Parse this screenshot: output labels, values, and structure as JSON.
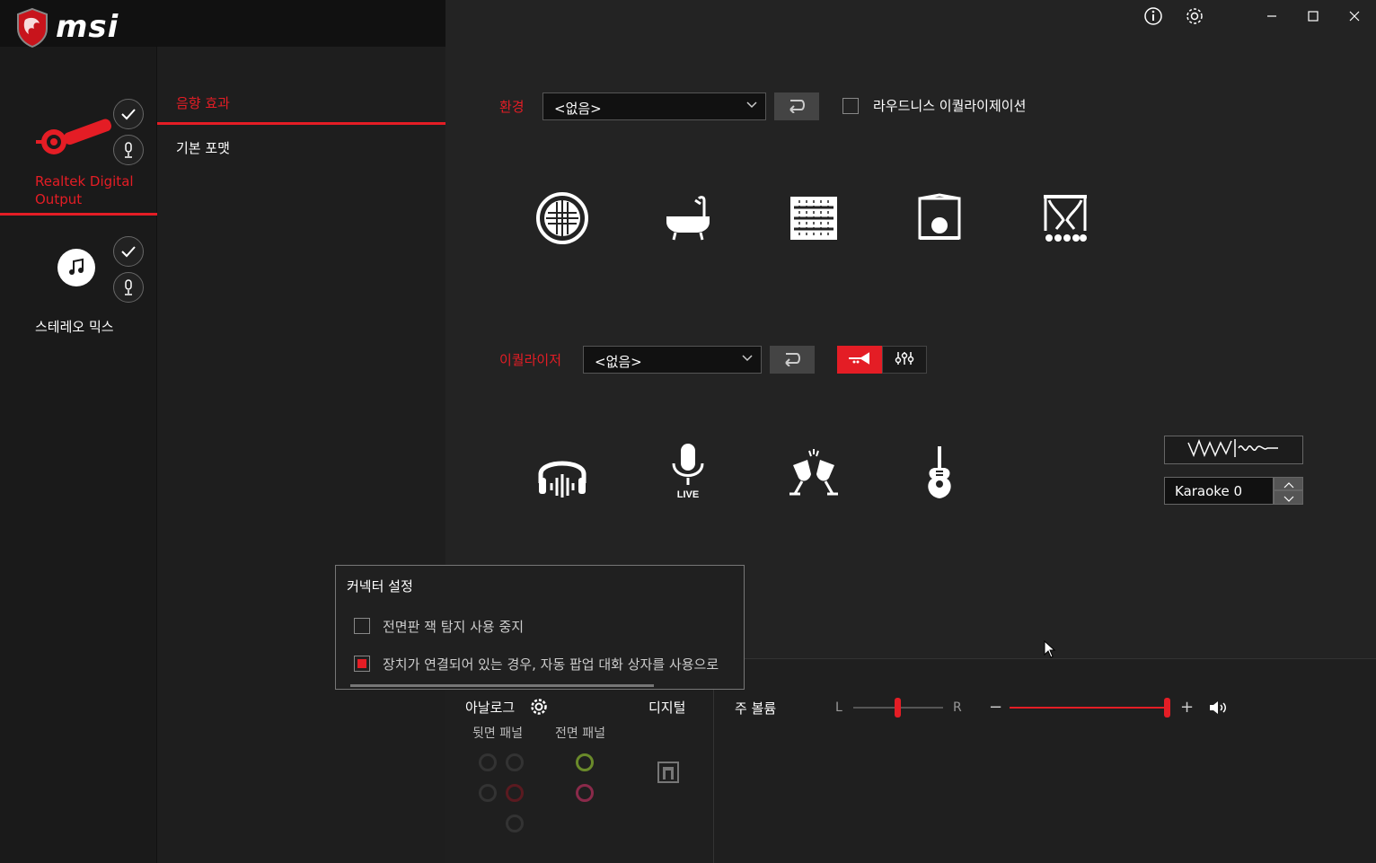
{
  "brand": {
    "logo_text": "msi"
  },
  "window_controls": {
    "info": "info",
    "settings": "settings",
    "minimize": "minimize",
    "maximize": "maximize",
    "close": "close"
  },
  "devices": [
    {
      "label": "Realtek Digital Output",
      "active": true
    },
    {
      "label": "스테레오 믹스",
      "active": false
    }
  ],
  "tabs": [
    {
      "label": "음향 효과",
      "active": true
    },
    {
      "label": "기본 포맷",
      "active": false
    }
  ],
  "environment": {
    "label": "환경",
    "value": "<없음>",
    "loudness_label": "라우드니스 이퀄라이제이션"
  },
  "env_icons": [
    "hall-icon",
    "bathroom-icon",
    "arena-icon",
    "stage-icon",
    "theater-icon"
  ],
  "equalizer": {
    "label": "이퀄라이저",
    "value": "<없음>"
  },
  "eq_icons": [
    "headphones-icon",
    "live-mic-icon",
    "party-icon",
    "guitar-icon"
  ],
  "karaoke": {
    "value": "Karaoke 0"
  },
  "connector_popup": {
    "title": "커넥터 설정",
    "option1": "전면판 잭 탐지 사용 중지",
    "option2": "장치가 연결되어 있는 경우, 자동 팝업 대화 상자를 사용으로"
  },
  "bottom": {
    "analog_label": "아날로그",
    "digital_label": "디지털",
    "rear_panel": "뒷면 패널",
    "front_panel": "전면 패널",
    "volume_label": "주 볼륨",
    "balance_l": "L",
    "balance_r": "R",
    "vol_minus": "−",
    "vol_plus": "+",
    "balance_level": 0.5,
    "volume_level": 1.0
  }
}
